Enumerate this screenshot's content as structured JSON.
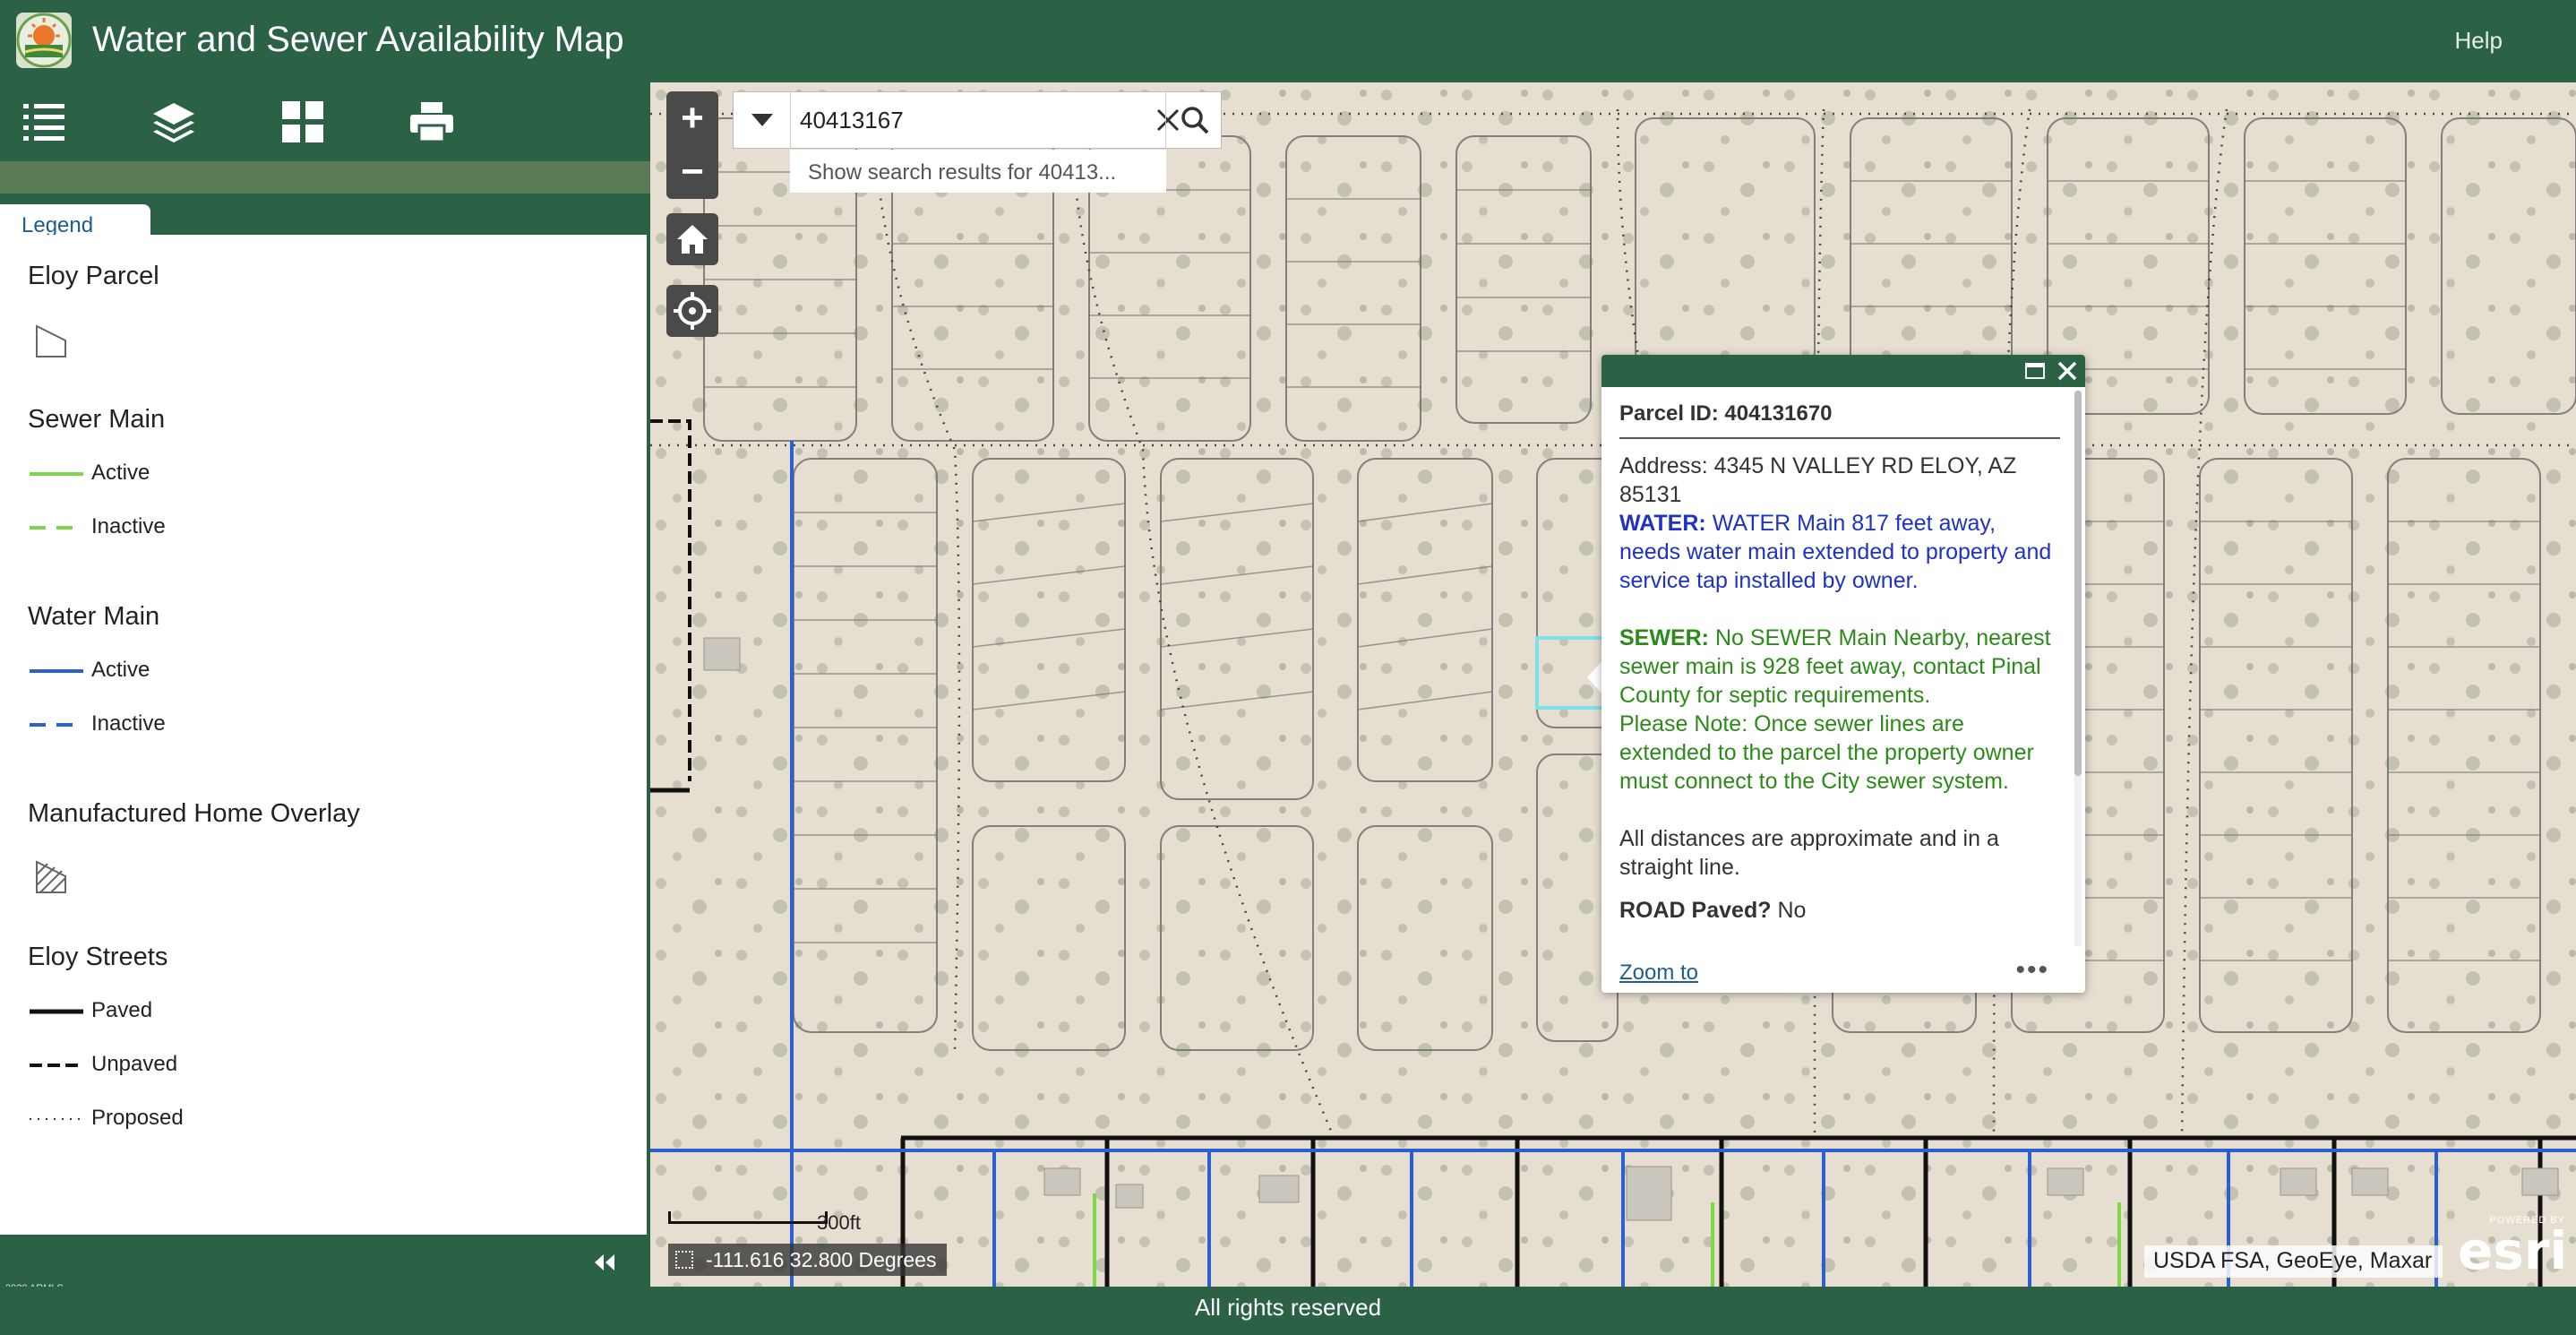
{
  "header": {
    "title": "Water and Sewer Availability Map",
    "help": "Help"
  },
  "toolbar": {
    "icons": [
      "legend-list-icon",
      "layers-icon",
      "basemap-grid-icon",
      "print-icon"
    ]
  },
  "panel": {
    "tab_label": "Legend",
    "groups": {
      "parcel": "Eloy Parcel",
      "sewer": "Sewer Main",
      "sewer_active": "Active",
      "sewer_inactive": "Inactive",
      "water": "Water Main",
      "water_active": "Active",
      "water_inactive": "Inactive",
      "mh": "Manufactured Home Overlay",
      "streets": "Eloy Streets",
      "streets_paved": "Paved",
      "streets_unpaved": "Unpaved",
      "streets_proposed": "Proposed"
    },
    "copyright": "2020 ARMLS"
  },
  "search": {
    "value": "40413167",
    "suggestion": "Show search results for 40413..."
  },
  "popup": {
    "title": "Parcel ID: 404131670",
    "address": "Address: 4345 N VALLEY RD ELOY, AZ 85131",
    "water_label": "WATER:",
    "water_text": "WATER Main 817 feet away, needs water main extended to property and service tap installed by owner.",
    "sewer_label": "SEWER:",
    "sewer_text": "No SEWER Main Nearby, nearest sewer main is 928 feet away, contact Pinal County for septic requirements.",
    "sewer_note": "Please Note: Once sewer lines are extended to the parcel the property owner must connect to the City sewer system.",
    "distances": "All distances are approximate and in a straight line.",
    "road_label": "ROAD Paved?",
    "road_value": "No",
    "zoom_to": "Zoom to",
    "more": "•••"
  },
  "map": {
    "scale": "300ft",
    "coordinates": "-111.616 32.800 Degrees",
    "attribution": "USDA FSA, GeoEye, Maxar",
    "powered_by": "POWERED BY",
    "esri": "esri"
  },
  "footer": {
    "text": "All rights reserved"
  },
  "colors": {
    "header": "#2b6245",
    "sewer_main": "#7ed64a",
    "water_main": "#2d5fd1",
    "street": "#111111",
    "parcel_line": "#6e6e6e"
  }
}
